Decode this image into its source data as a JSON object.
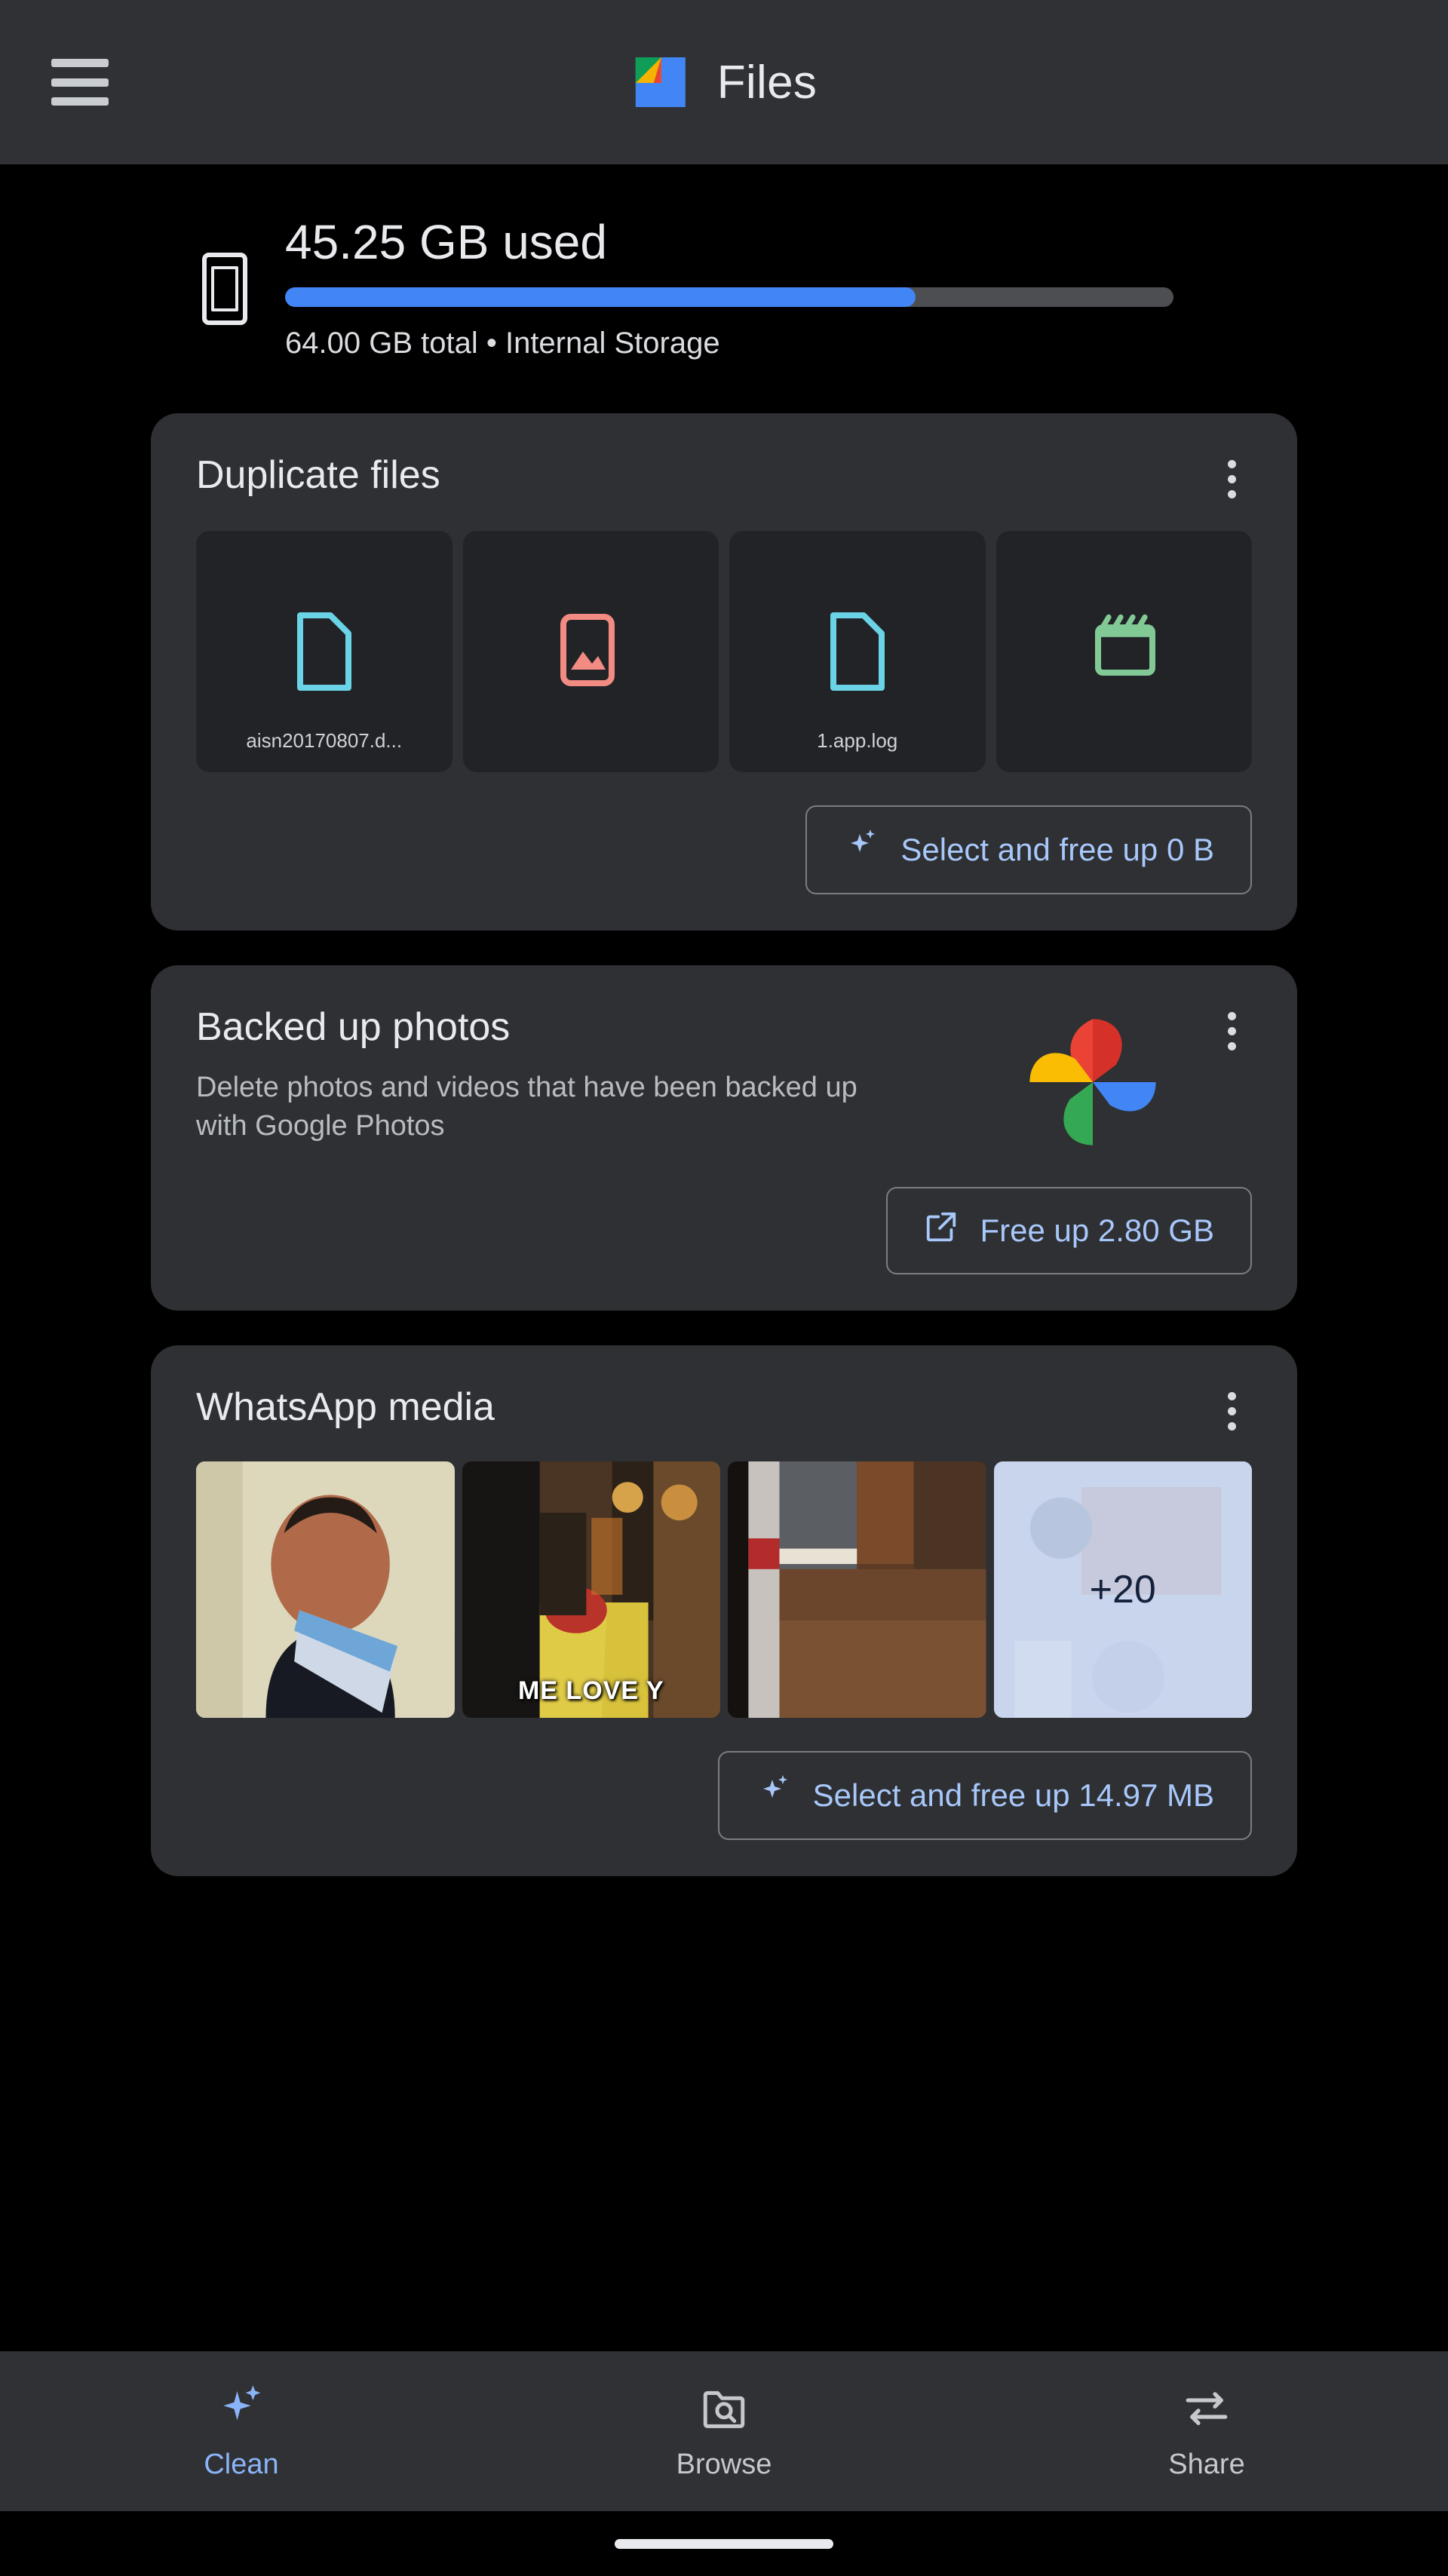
{
  "app": {
    "title": "Files",
    "menu_icon": "hamburger-menu-icon",
    "logo_icon": "google-files-logo"
  },
  "storage": {
    "used_label": "45.25 GB used",
    "total_label": "64.00 GB total • Internal Storage",
    "percent_used": 71,
    "device_icon": "phone-icon",
    "bar_color": "#4285f4",
    "track_color": "#4c4e51"
  },
  "cards": [
    {
      "id": "duplicate-files",
      "title": "Duplicate files",
      "menu_icon": "more-vert-icon",
      "tiles": [
        {
          "icon": "document-file-icon",
          "icon_color": "#6ad3e6",
          "name": "aisn20170807.d..."
        },
        {
          "icon": "image-file-icon",
          "icon_color": "#f28b82",
          "name": ""
        },
        {
          "icon": "document-file-icon",
          "icon_color": "#6ad3e6",
          "name": "1.app.log"
        },
        {
          "icon": "video-file-icon",
          "icon_color": "#81c995",
          "name": ""
        }
      ],
      "button": {
        "label": "Select and free up 0 B",
        "icon": "sparkle-icon"
      }
    },
    {
      "id": "backed-up-photos",
      "title": "Backed up photos",
      "subtitle": "Delete photos and videos that have been backed up with Google Photos",
      "menu_icon": "more-vert-icon",
      "brand_icon": "google-photos-icon",
      "button": {
        "label": "Free up 2.80 GB",
        "icon": "open-in-new-icon"
      }
    },
    {
      "id": "whatsapp-media",
      "title": "WhatsApp media",
      "menu_icon": "more-vert-icon",
      "thumbnails": [
        {
          "alt": "man-holding-paper-photo",
          "caption": ""
        },
        {
          "alt": "living-room-scene-photo",
          "caption": "ME LOVE Y"
        },
        {
          "alt": "hallway-floor-photo",
          "caption": ""
        },
        {
          "alt": "more-photos-overlay",
          "caption": "",
          "overlay": "+20"
        }
      ],
      "button": {
        "label": "Select and free up 14.97 MB",
        "icon": "sparkle-icon"
      }
    }
  ],
  "bottom_nav": {
    "items": [
      {
        "label": "Clean",
        "icon": "sparkle-icon",
        "active": true
      },
      {
        "label": "Browse",
        "icon": "folder-search-icon",
        "active": false
      },
      {
        "label": "Share",
        "icon": "share-transfer-icon",
        "active": false
      }
    ],
    "active_color": "#8ab4f8"
  }
}
